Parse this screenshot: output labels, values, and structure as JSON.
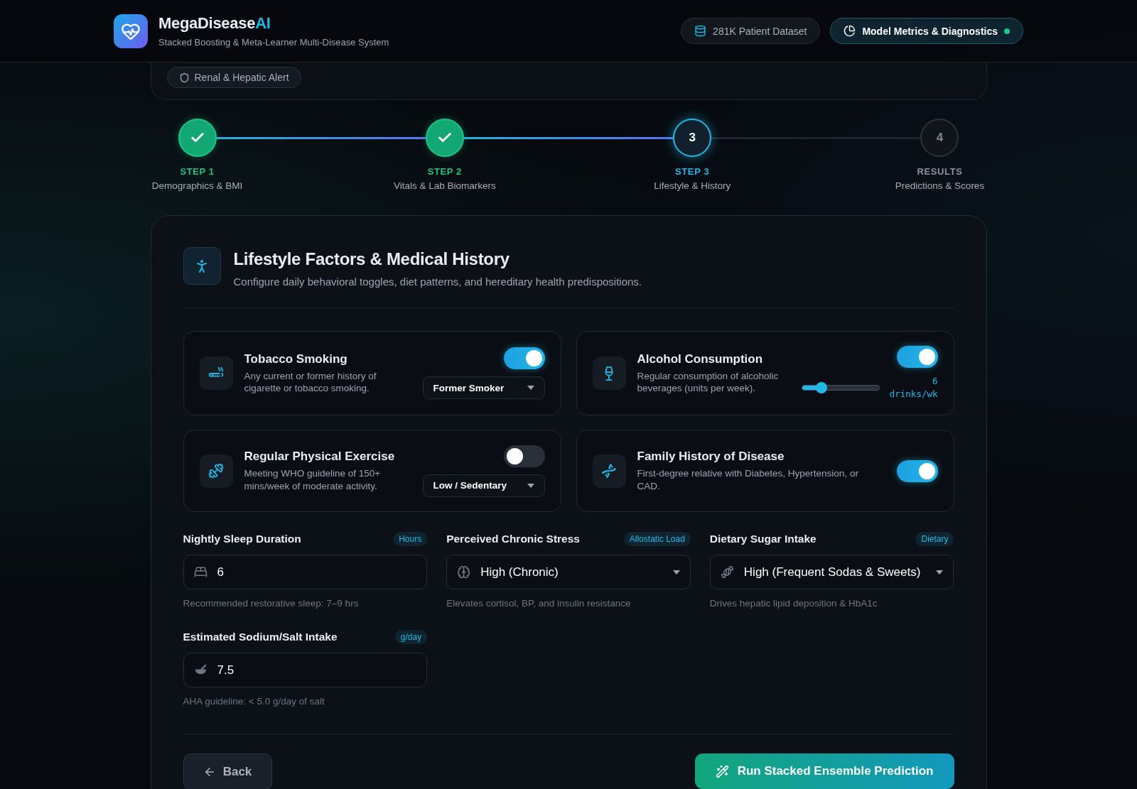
{
  "header": {
    "logo_text": "MegaDisease",
    "logo_accent": "AI",
    "subtitle": "Stacked Boosting & Meta-Learner Multi-Disease System",
    "buttons": [
      {
        "label": "281K Patient Dataset",
        "kind": "dataset",
        "live": false
      },
      {
        "label": "Model Metrics & Diagnostics",
        "kind": "metrics",
        "live": true
      }
    ]
  },
  "previous_card": {
    "chips": [
      "Renal & Hepatic Alert"
    ]
  },
  "stepper": {
    "steps": [
      {
        "title": "STEP 1",
        "label": "Demographics & BMI",
        "completed": true,
        "selected": false
      },
      {
        "title": "STEP 2",
        "label": "Vitals & Lab Biomarkers",
        "completed": true,
        "selected": false
      },
      {
        "title": "STEP 3",
        "label": "Lifestyle & History",
        "completed": false,
        "selected": true,
        "number": "3"
      },
      {
        "title": "RESULTS",
        "label": "Predictions & Scores",
        "completed": false,
        "selected": false,
        "number": "4"
      }
    ]
  },
  "section": {
    "title": "Lifestyle Factors & Medical History",
    "subtitle": "Configure daily behavioral toggles, diet patterns, and hereditary health predispositions."
  },
  "toggles": [
    {
      "kind": "select",
      "title": "Tobacco Smoking",
      "description": "Any current or former history of cigarette or tobacco smoking.",
      "on": true,
      "value": "Former Smoker"
    },
    {
      "kind": "slider",
      "title": "Alcohol Consumption",
      "description": "Regular consumption of alcoholic beverages (units per week).",
      "on": true,
      "level": 0.25,
      "reading": "6",
      "unit": "drinks/wk"
    },
    {
      "kind": "select",
      "title": "Regular Physical Exercise",
      "description": "Meeting WHO guideline of 150+ mins/week of moderate activity.",
      "on": false,
      "value": "Low / Sedentary"
    },
    {
      "kind": "plain",
      "title": "Family History of Disease",
      "description": "First-degree relative with Diabetes, Hypertension, or CAD.",
      "on": true
    }
  ],
  "fields": [
    {
      "kind": "input",
      "label": "Nightly Sleep Duration",
      "badge": "Hours",
      "value": "6",
      "help": "Recommended restorative sleep: 7–9 hrs"
    },
    {
      "kind": "select",
      "label": "Perceived Chronic Stress",
      "badge": "Allostatic Load",
      "value": "High (Chronic)",
      "help": "Elevates cortisol, BP, and insulin resistance"
    },
    {
      "kind": "select",
      "label": "Dietary Sugar Intake",
      "badge": "Dietary",
      "value": "High (Frequent Sodas & Sweets)",
      "help": "Drives hepatic lipid deposition & HbA1c"
    },
    {
      "kind": "input",
      "label": "Estimated Sodium/Salt Intake",
      "badge": "g/day",
      "value": "7.5",
      "help": "AHA guideline: < 5.0 g/day of salt"
    }
  ],
  "actions": {
    "back": "Back",
    "run": "Run Stacked Ensemble Prediction"
  }
}
